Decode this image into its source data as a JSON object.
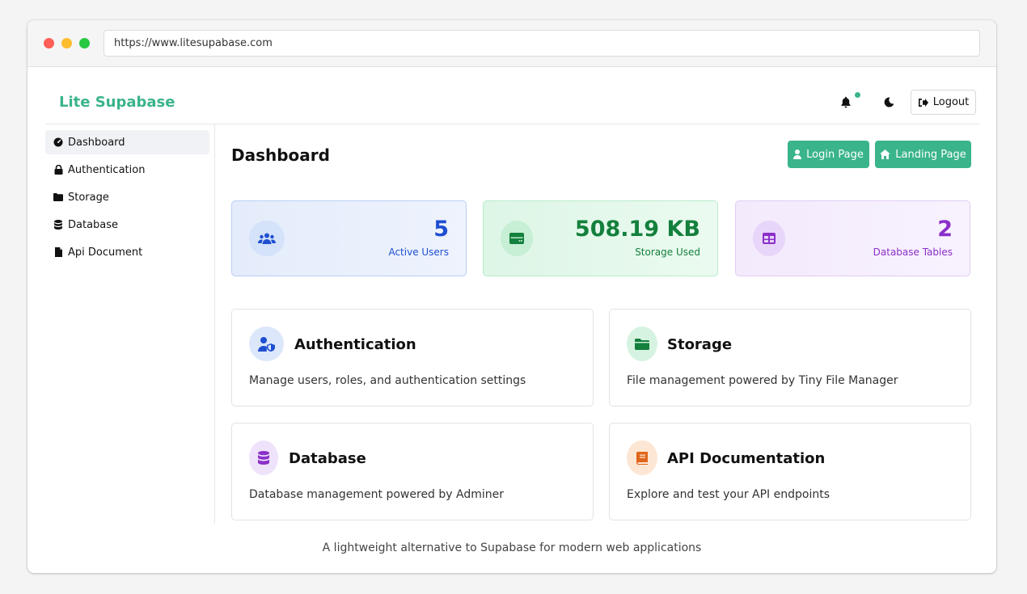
{
  "browser": {
    "url": "https://www.litesupabase.com"
  },
  "header": {
    "brand": "Lite Supabase",
    "logout_label": "Logout"
  },
  "sidebar": {
    "items": [
      {
        "label": "Dashboard",
        "icon": "dashboard-icon",
        "active": true
      },
      {
        "label": "Authentication",
        "icon": "lock-icon"
      },
      {
        "label": "Storage",
        "icon": "folder-icon"
      },
      {
        "label": "Database",
        "icon": "database-icon"
      },
      {
        "label": "Api Document",
        "icon": "document-icon"
      }
    ]
  },
  "main": {
    "title": "Dashboard",
    "buttons": {
      "login_label": "Login Page",
      "landing_label": "Landing Page"
    },
    "stats": [
      {
        "value": "5",
        "label": "Active Users",
        "icon": "users-icon",
        "color": "#1f4fd1"
      },
      {
        "value": "508.19 KB",
        "label": "Storage Used",
        "icon": "hard-drive-icon",
        "color": "#14803d"
      },
      {
        "value": "2",
        "label": "Database Tables",
        "icon": "table-icon",
        "color": "#8b2fc9"
      }
    ],
    "cards": [
      {
        "title": "Authentication",
        "desc": "Manage users, roles, and authentication settings",
        "icon": "user-shield-icon"
      },
      {
        "title": "Storage",
        "desc": "File management powered by Tiny File Manager",
        "icon": "folder-icon"
      },
      {
        "title": "Database",
        "desc": "Database management powered by Adminer",
        "icon": "database-icon"
      },
      {
        "title": "API Documentation",
        "desc": "Explore and test your API endpoints",
        "icon": "book-icon"
      }
    ]
  },
  "footer": {
    "text": "A lightweight alternative to Supabase for modern web applications"
  },
  "colors": {
    "accent": "#3ab48a"
  }
}
